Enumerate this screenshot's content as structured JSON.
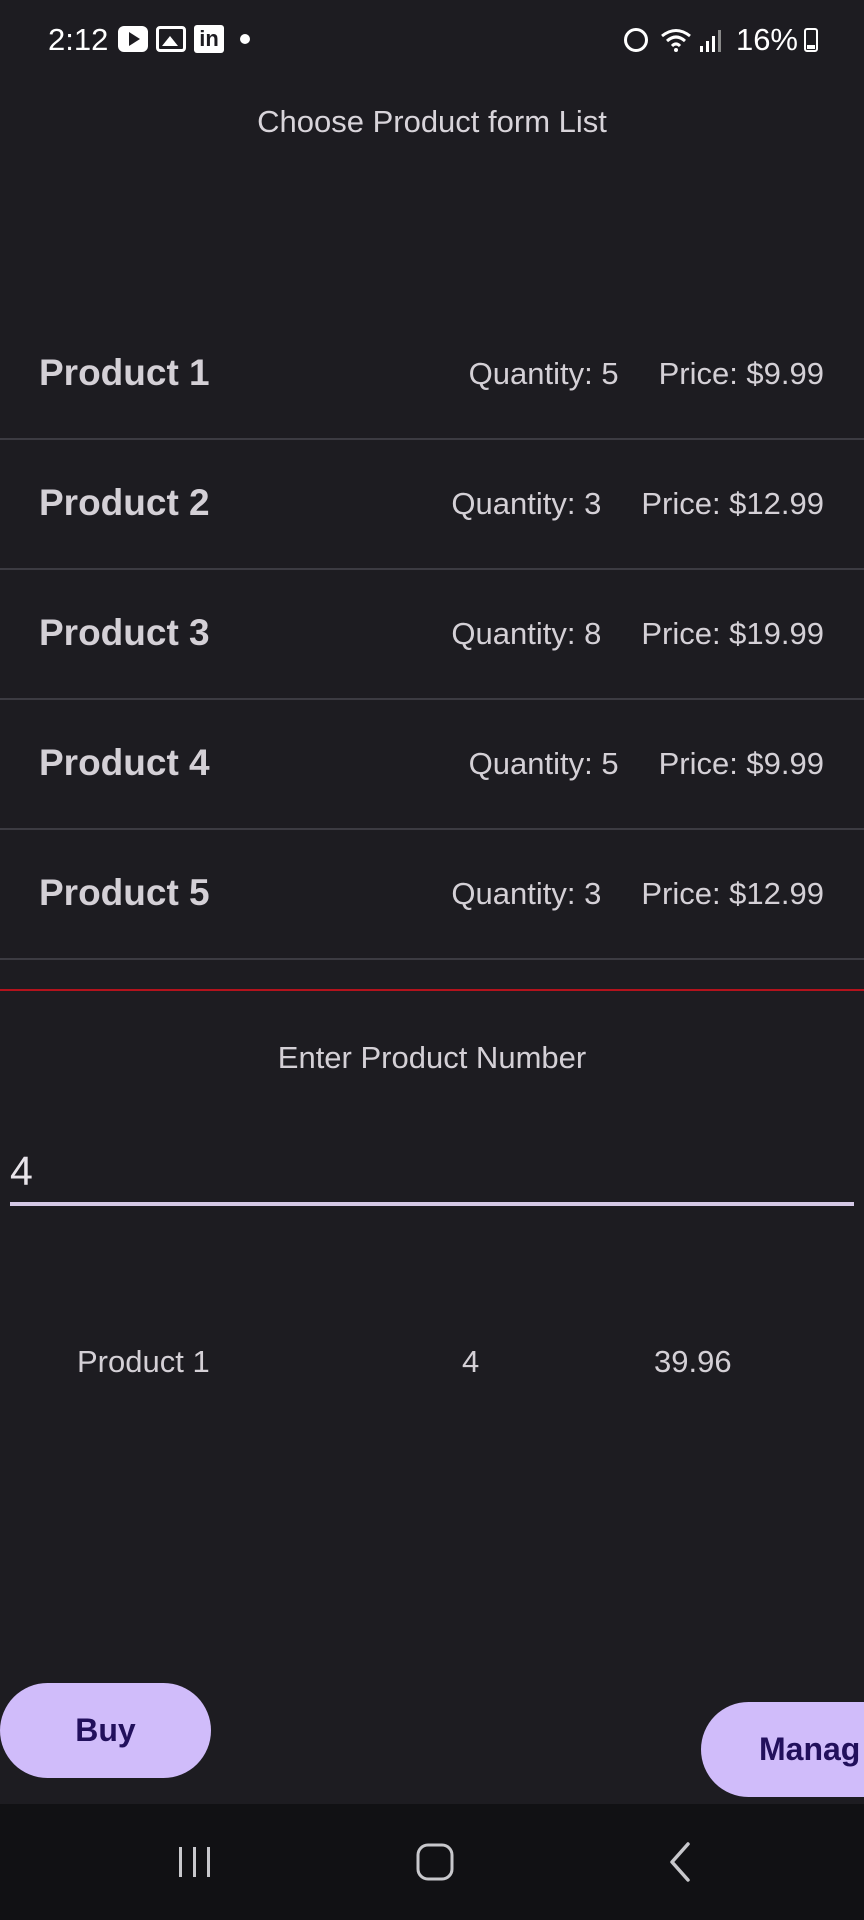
{
  "status_bar": {
    "time": "2:12",
    "battery": "16%",
    "left_icons": [
      "youtube-icon",
      "gallery-icon",
      "linkedin-icon",
      "dot-icon"
    ],
    "right_icons": [
      "alarm-icon",
      "wifi-icon",
      "signal-icon",
      "battery-icon"
    ]
  },
  "header": {
    "title": "Choose Product form List"
  },
  "products": [
    {
      "name": "Product 1",
      "quantity": "Quantity: 5",
      "price": "Price: $9.99"
    },
    {
      "name": "Product 2",
      "quantity": "Quantity: 3",
      "price": "Price: $12.99"
    },
    {
      "name": "Product 3",
      "quantity": "Quantity: 8",
      "price": "Price: $19.99"
    },
    {
      "name": "Product 4",
      "quantity": "Quantity: 5",
      "price": "Price: $9.99"
    },
    {
      "name": "Product 5",
      "quantity": "Quantity: 3",
      "price": "Price: $12.99"
    }
  ],
  "input": {
    "label": "Enter Product Number",
    "value": "4"
  },
  "result": {
    "product": "Product 1",
    "quantity": "4",
    "total": "39.96"
  },
  "actions": {
    "buy_label": "Buy",
    "manage_label": "Manag"
  },
  "nav": {
    "items": [
      "recents-icon",
      "home-icon",
      "back-icon"
    ]
  },
  "colors": {
    "background": "#1d1c21",
    "accent_button": "#d0bcfa",
    "button_text": "#22105c",
    "divider_red": "#b3121c",
    "nav_background": "#111114"
  }
}
